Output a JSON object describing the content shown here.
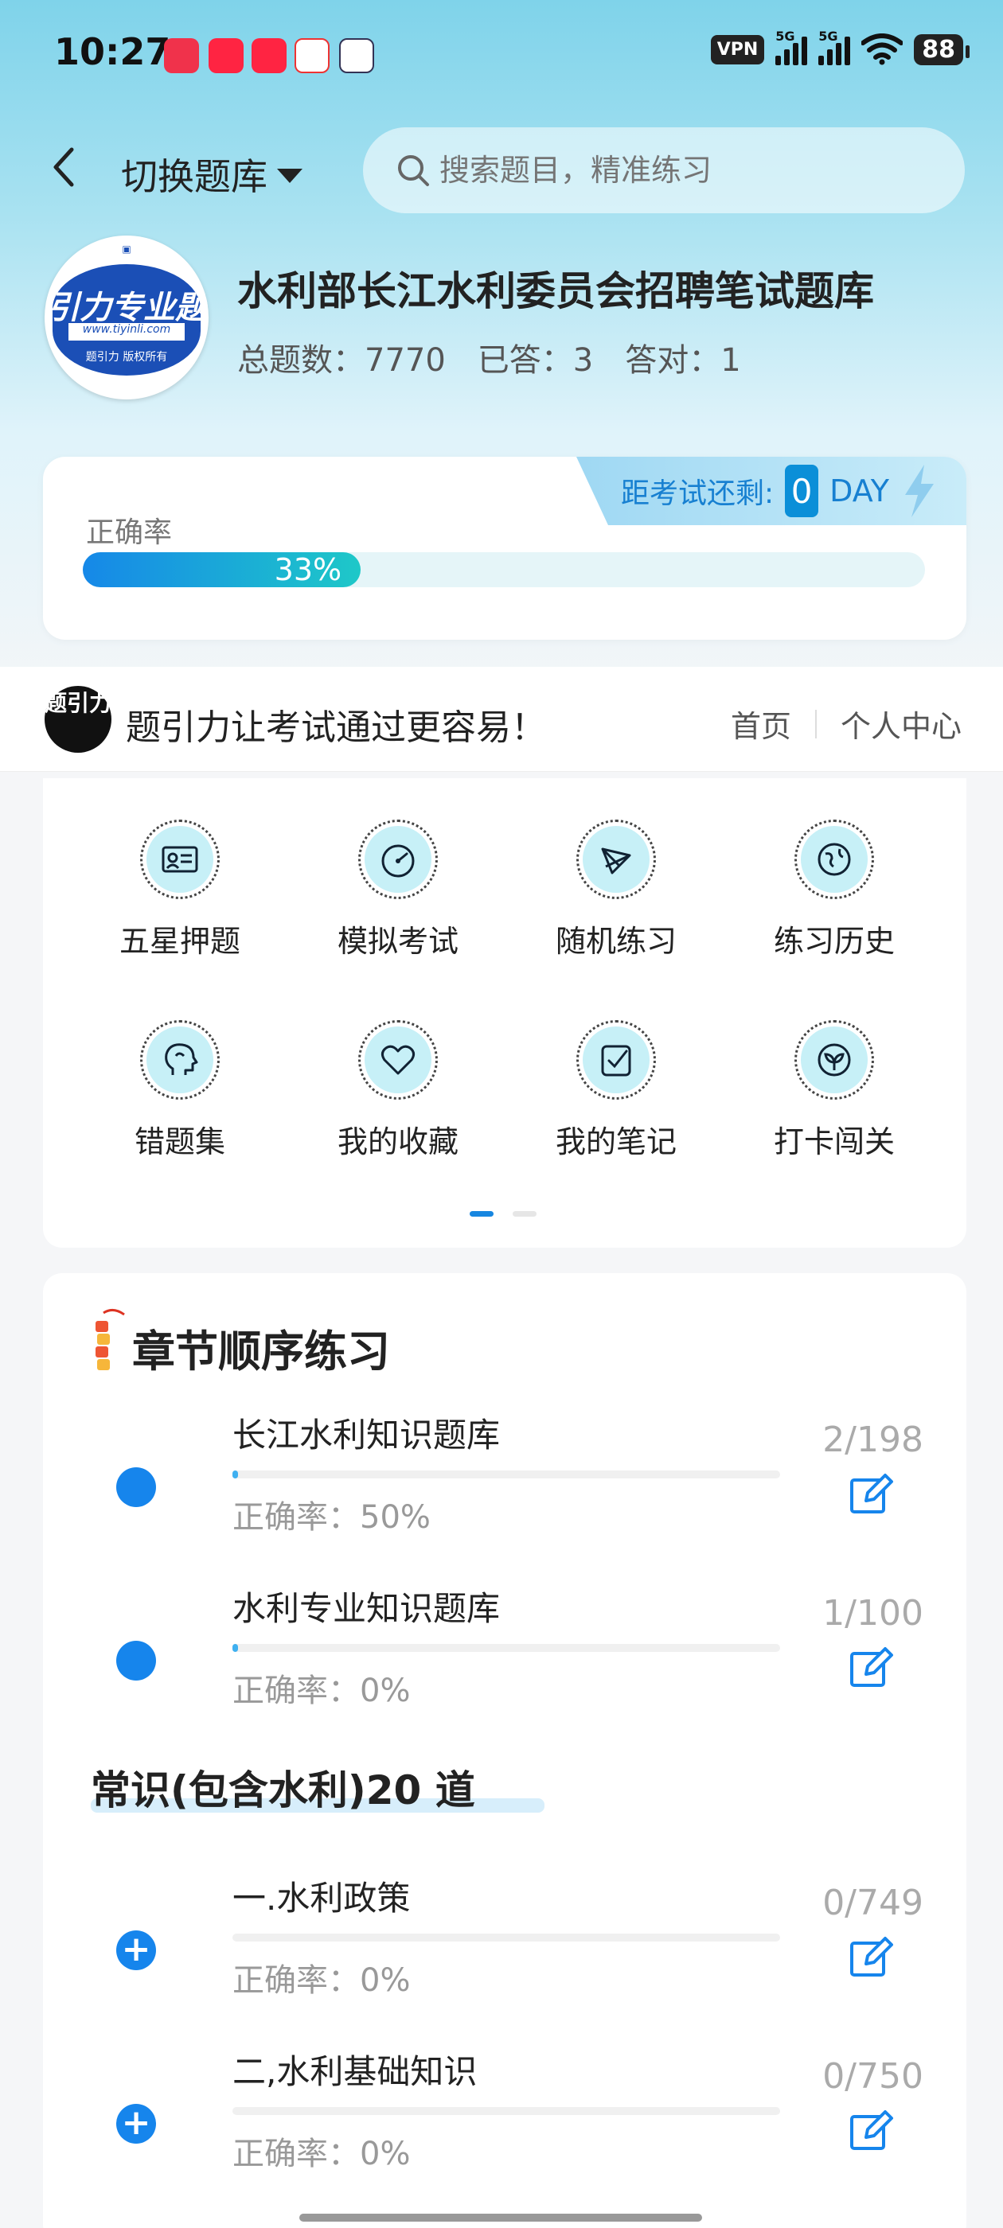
{
  "status_bar": {
    "time": "10:27",
    "vpn": "VPN",
    "signal1": "5G",
    "signal2": "5G",
    "battery": "88"
  },
  "header": {
    "switch_label": "切换题库",
    "search_placeholder": "搜索题目，精准练习"
  },
  "bank": {
    "title": "水利部长江水利委员会招聘笔试题库",
    "logo_text": "引力专业题",
    "logo_url": "www.tiyinli.com",
    "logo_copy": "题引力 版权所有",
    "stats": {
      "total": "总题数：7770",
      "answered": "已答：3",
      "correct": "答对：1"
    }
  },
  "accuracy": {
    "label": "正确率",
    "percent_text": "33%",
    "percent": 33,
    "countdown_label": "距考试还剩:",
    "countdown_value": "0",
    "countdown_unit": "DAY"
  },
  "promo": {
    "logo_text": "题引力",
    "text": "题引力让考试通过更容易！",
    "links": [
      "首页",
      "个人中心"
    ]
  },
  "features": [
    {
      "label": "五星押题",
      "icon": "id-card-icon"
    },
    {
      "label": "模拟考试",
      "icon": "speedometer-icon"
    },
    {
      "label": "随机练习",
      "icon": "shuffle-icon"
    },
    {
      "label": "练习历史",
      "icon": "globe-icon"
    },
    {
      "label": "错题集",
      "icon": "head-icon"
    },
    {
      "label": "我的收藏",
      "icon": "heart-icon"
    },
    {
      "label": "我的笔记",
      "icon": "note-check-icon"
    },
    {
      "label": "打卡闯关",
      "icon": "sprout-icon"
    }
  ],
  "pagination": {
    "pages": 2,
    "active": 0
  },
  "chapters": {
    "title": "章节顺序练习",
    "items": [
      {
        "name": "长江水利知识题库",
        "accuracy": "正确率：50%",
        "count": "2/198",
        "progress": 0.01
      },
      {
        "name": "水利专业知识题库",
        "accuracy": "正确率：0%",
        "count": "1/100",
        "progress": 0.01
      }
    ],
    "section_title": "常识(包含水利)20 道",
    "section_items": [
      {
        "name": "一.水利政策",
        "accuracy": "正确率：0%",
        "count": "0/749",
        "progress": 0
      },
      {
        "name": "二,水利基础知识",
        "accuracy": "正确率：0%",
        "count": "0/750",
        "progress": 0
      }
    ]
  },
  "colors": {
    "accent": "#1685ec",
    "progress_start": "#1688e8",
    "progress_end": "#1ec8c8",
    "icon_bg": "#c7f0f7"
  }
}
